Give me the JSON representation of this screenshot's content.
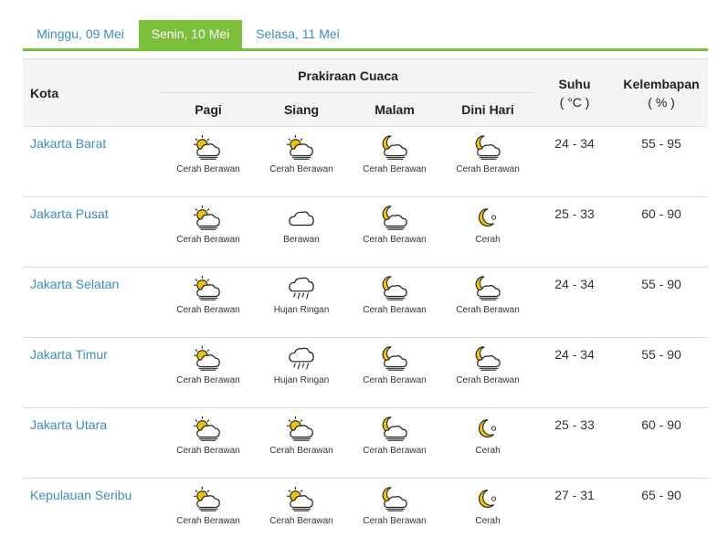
{
  "tabs": [
    {
      "label": "Minggu, 09 Mei",
      "active": false
    },
    {
      "label": "Senin, 10 Mei",
      "active": true
    },
    {
      "label": "Selasa, 11 Mei",
      "active": false
    }
  ],
  "colors": {
    "accent": "#7cbf3a",
    "link": "#3c8dbc",
    "sun": "#f2c200"
  },
  "table": {
    "col_city": "Kota",
    "col_forecast": "Prakiraan Cuaca",
    "periods": [
      "Pagi",
      "Siang",
      "Malam",
      "Dini Hari"
    ],
    "col_temp": "Suhu",
    "col_temp_unit": "( °C )",
    "col_humidity": "Kelembapan",
    "col_humidity_unit": "( % )",
    "rows": [
      {
        "city": "Jakarta Barat",
        "weather": [
          {
            "icon": "sun-cloud-icon",
            "label": "Cerah Berawan"
          },
          {
            "icon": "sun-cloud-icon",
            "label": "Cerah Berawan"
          },
          {
            "icon": "moon-cloud-icon",
            "label": "Cerah Berawan"
          },
          {
            "icon": "moon-cloud-icon",
            "label": "Cerah Berawan"
          }
        ],
        "temp": "24 - 34",
        "humidity": "55 - 95"
      },
      {
        "city": "Jakarta Pusat",
        "weather": [
          {
            "icon": "sun-cloud-icon",
            "label": "Cerah Berawan"
          },
          {
            "icon": "cloud-icon",
            "label": "Berawan"
          },
          {
            "icon": "moon-cloud-icon",
            "label": "Cerah Berawan"
          },
          {
            "icon": "moon-icon",
            "label": "Cerah"
          }
        ],
        "temp": "25 - 33",
        "humidity": "60 - 90"
      },
      {
        "city": "Jakarta Selatan",
        "weather": [
          {
            "icon": "sun-cloud-icon",
            "label": "Cerah Berawan"
          },
          {
            "icon": "rain-cloud-icon",
            "label": "Hujan Ringan"
          },
          {
            "icon": "moon-cloud-icon",
            "label": "Cerah Berawan"
          },
          {
            "icon": "moon-cloud-icon",
            "label": "Cerah Berawan"
          }
        ],
        "temp": "24 - 34",
        "humidity": "55 - 90"
      },
      {
        "city": "Jakarta Timur",
        "weather": [
          {
            "icon": "sun-cloud-icon",
            "label": "Cerah Berawan"
          },
          {
            "icon": "rain-cloud-icon",
            "label": "Hujan Ringan"
          },
          {
            "icon": "moon-cloud-icon",
            "label": "Cerah Berawan"
          },
          {
            "icon": "moon-cloud-icon",
            "label": "Cerah Berawan"
          }
        ],
        "temp": "24 - 34",
        "humidity": "55 - 90"
      },
      {
        "city": "Jakarta Utara",
        "weather": [
          {
            "icon": "sun-cloud-icon",
            "label": "Cerah Berawan"
          },
          {
            "icon": "sun-cloud-icon",
            "label": "Cerah Berawan"
          },
          {
            "icon": "moon-cloud-icon",
            "label": "Cerah Berawan"
          },
          {
            "icon": "moon-icon",
            "label": "Cerah"
          }
        ],
        "temp": "25 - 33",
        "humidity": "60 - 90"
      },
      {
        "city": "Kepulauan Seribu",
        "weather": [
          {
            "icon": "sun-cloud-icon",
            "label": "Cerah Berawan"
          },
          {
            "icon": "sun-cloud-icon",
            "label": "Cerah Berawan"
          },
          {
            "icon": "moon-cloud-icon",
            "label": "Cerah Berawan"
          },
          {
            "icon": "moon-icon",
            "label": "Cerah"
          }
        ],
        "temp": "27 - 31",
        "humidity": "65 - 90"
      }
    ]
  }
}
